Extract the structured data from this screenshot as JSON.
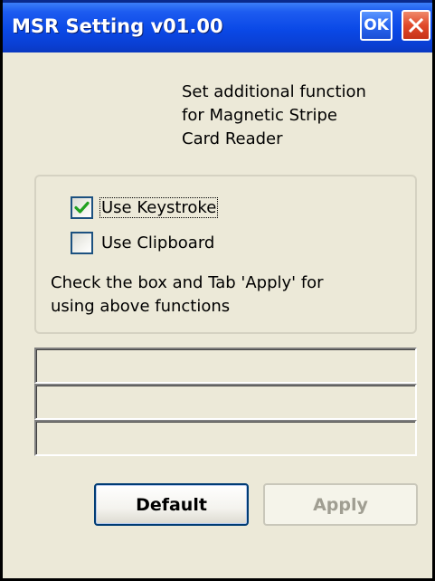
{
  "window": {
    "title": "MSR Setting v01.00",
    "ok_label": "OK"
  },
  "description": {
    "lines": [
      "Set additional function",
      "for Magnetic Stripe",
      "Card Reader"
    ]
  },
  "options": [
    {
      "label": "Use Keystroke",
      "checked": true
    },
    {
      "label": "Use Clipboard",
      "checked": false
    }
  ],
  "hint": {
    "lines": [
      "Check the box and Tab 'Apply' for",
      "using above functions"
    ]
  },
  "fields": [
    {
      "value": ""
    },
    {
      "value": ""
    },
    {
      "value": ""
    }
  ],
  "buttons": {
    "default_label": "Default",
    "apply_label": "Apply",
    "apply_enabled": false
  },
  "colors": {
    "titlebar": "#0a48e6",
    "close": "#e0492a",
    "window_bg": "#ece9d8",
    "check_mark": "#21a121"
  }
}
